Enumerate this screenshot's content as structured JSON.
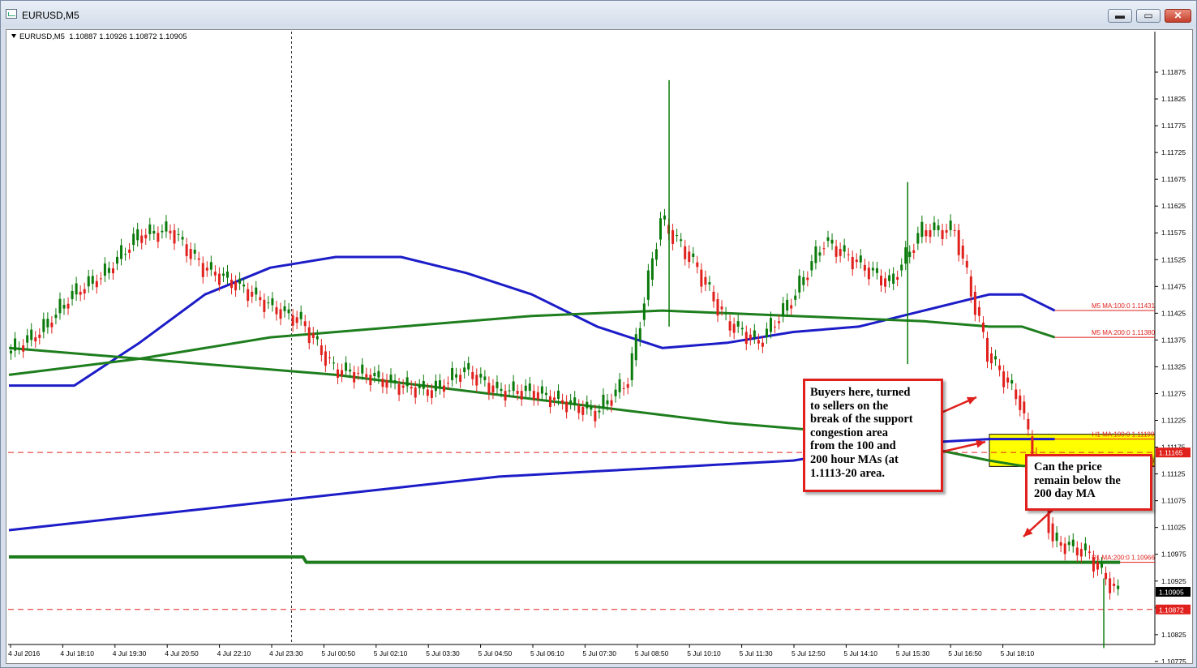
{
  "window": {
    "title": "EURUSD,M5",
    "buttons": {
      "minimize": "▬",
      "maximize": "▭",
      "close": "✕"
    }
  },
  "symbol": {
    "name": "EURUSD,M5",
    "ohlc": "1.10887 1.10926 1.10872 1.10905"
  },
  "chart_data": {
    "type": "line",
    "title": "",
    "y_range": [
      1.1076,
      1.1192
    ],
    "y_ticks": [
      "1.11875",
      "1.11825",
      "1.11775",
      "1.11725",
      "1.11675",
      "1.11625",
      "1.11575",
      "1.11525",
      "1.11475",
      "1.11425",
      "1.11375",
      "1.11325",
      "1.11275",
      "1.11225",
      "1.11175",
      "1.11125",
      "1.11075",
      "1.11025",
      "1.10975",
      "1.10925",
      "1.10875",
      "1.10825",
      "1.10775"
    ],
    "x_ticks": [
      "4 Jul 2016",
      "4 Jul 18:10",
      "4 Jul 19:30",
      "4 Jul 20:50",
      "4 Jul 22:10",
      "4 Jul 23:30",
      "5 Jul 00:50",
      "5 Jul 02:10",
      "5 Jul 03:30",
      "5 Jul 04:50",
      "5 Jul 06:10",
      "5 Jul 07:30",
      "5 Jul 08:50",
      "5 Jul 10:10",
      "5 Jul 11:30",
      "5 Jul 12:50",
      "5 Jul 14:10",
      "5 Jul 15:30",
      "5 Jul 16:50",
      "5 Jul 18:10"
    ],
    "price_path": [
      [
        0,
        1.1135
      ],
      [
        1,
        1.1139
      ],
      [
        2,
        1.1146
      ],
      [
        3,
        1.115
      ],
      [
        4,
        1.1157
      ],
      [
        5,
        1.1158
      ],
      [
        6,
        1.1151
      ],
      [
        7,
        1.1148
      ],
      [
        8,
        1.1144
      ],
      [
        9,
        1.1141
      ],
      [
        10,
        1.1132
      ],
      [
        11,
        1.1131
      ],
      [
        12,
        1.1129
      ],
      [
        13,
        1.1128
      ],
      [
        14,
        1.1132
      ],
      [
        15,
        1.1128
      ],
      [
        16,
        1.1128
      ],
      [
        17,
        1.1126
      ],
      [
        18,
        1.1124
      ],
      [
        19,
        1.113
      ],
      [
        20,
        1.116
      ],
      [
        21,
        1.1152
      ],
      [
        22,
        1.1141
      ],
      [
        23,
        1.1137
      ],
      [
        24,
        1.1145
      ],
      [
        25,
        1.1156
      ],
      [
        26,
        1.1152
      ],
      [
        27,
        1.1148
      ],
      [
        28,
        1.1158
      ],
      [
        29,
        1.1158
      ],
      [
        30,
        1.1135
      ],
      [
        31,
        1.1126
      ],
      [
        32,
        1.11
      ],
      [
        33,
        1.1098
      ],
      [
        34,
        1.109
      ]
    ],
    "price_spikes": [
      {
        "x": 20.2,
        "high": 1.1186,
        "low": 1.114
      },
      {
        "x": 27.5,
        "high": 1.1167,
        "low": 1.1133
      },
      {
        "x": 33.5,
        "high": 1.1093,
        "low": 1.108
      }
    ],
    "series": [
      {
        "label": "M5 MA:100:0",
        "value_text": "1.11431",
        "points": [
          [
            0,
            1.1129
          ],
          [
            2,
            1.1129
          ],
          [
            4,
            1.1137
          ],
          [
            6,
            1.1146
          ],
          [
            8,
            1.1151
          ],
          [
            10,
            1.1153
          ],
          [
            12,
            1.1153
          ],
          [
            14,
            1.115
          ],
          [
            16,
            1.1146
          ],
          [
            18,
            1.114
          ],
          [
            20,
            1.1136
          ],
          [
            22,
            1.1137
          ],
          [
            24,
            1.1139
          ],
          [
            26,
            1.114
          ],
          [
            28,
            1.1143
          ],
          [
            30,
            1.1146
          ],
          [
            31,
            1.1146
          ],
          [
            32,
            1.1143
          ]
        ]
      },
      {
        "label": "M5 MA:200:0",
        "value_text": "1.11380",
        "points": [
          [
            0,
            1.1131
          ],
          [
            4,
            1.1134
          ],
          [
            8,
            1.1138
          ],
          [
            12,
            1.114
          ],
          [
            16,
            1.1142
          ],
          [
            20,
            1.1143
          ],
          [
            24,
            1.1142
          ],
          [
            28,
            1.1141
          ],
          [
            30,
            1.114
          ],
          [
            31,
            1.114
          ],
          [
            32,
            1.1138
          ]
        ]
      },
      {
        "label": "H1 MA:100:0",
        "value_text": "1.11199",
        "points": [
          [
            0,
            1.1102
          ],
          [
            3,
            1.1104
          ],
          [
            6,
            1.1106
          ],
          [
            9,
            1.1108
          ],
          [
            12,
            1.111
          ],
          [
            15,
            1.1112
          ],
          [
            18,
            1.1113
          ],
          [
            21,
            1.1114
          ],
          [
            24,
            1.1115
          ],
          [
            27,
            1.1118
          ],
          [
            30,
            1.1119
          ],
          [
            31,
            1.1119
          ],
          [
            32,
            1.1119
          ]
        ]
      },
      {
        "label": "H1 MA:200:0",
        "value_text": "1.11139",
        "points": [
          [
            0,
            1.1136
          ],
          [
            6,
            1.1133
          ],
          [
            10,
            1.1131
          ],
          [
            14,
            1.1128
          ],
          [
            18,
            1.1125
          ],
          [
            22,
            1.1122
          ],
          [
            26,
            1.112
          ],
          [
            30,
            1.1115
          ],
          [
            31,
            1.1114
          ],
          [
            32,
            1.1114
          ]
        ]
      },
      {
        "label": "D1 MA:200:0",
        "value_text": "1.10966",
        "points": [
          [
            0,
            1.1097
          ],
          [
            9,
            1.1097
          ],
          [
            9.1,
            1.1096
          ],
          [
            34,
            1.1096
          ]
        ]
      }
    ],
    "levels": [
      {
        "name": "bid-line",
        "value": 1.11165,
        "label": "1.11165"
      },
      {
        "name": "current-price-line",
        "value": 1.10872,
        "label": "1.10872"
      }
    ],
    "current_price": {
      "value": 1.10905,
      "label": "1.10905"
    },
    "zone": {
      "from": 1.11139,
      "to": 1.11199
    }
  },
  "colors": {
    "bull": "#0a7a0a",
    "bear": "#e0201c",
    "ma_blue": "#1c1cc8",
    "ma_green": "#1e7e1e",
    "level_red": "#e0201c",
    "zone_yellow": "#ffff00",
    "label_red": "#e0201c"
  },
  "annotations": {
    "buyers": [
      "Buyers here, turned",
      "to sellers on the",
      "break of the support",
      "congestion area",
      "from the 100 and",
      "200 hour MAs (at",
      "1.1113-20 area."
    ],
    "price": [
      "Can the price",
      "remain below the",
      "200 day MA"
    ]
  }
}
